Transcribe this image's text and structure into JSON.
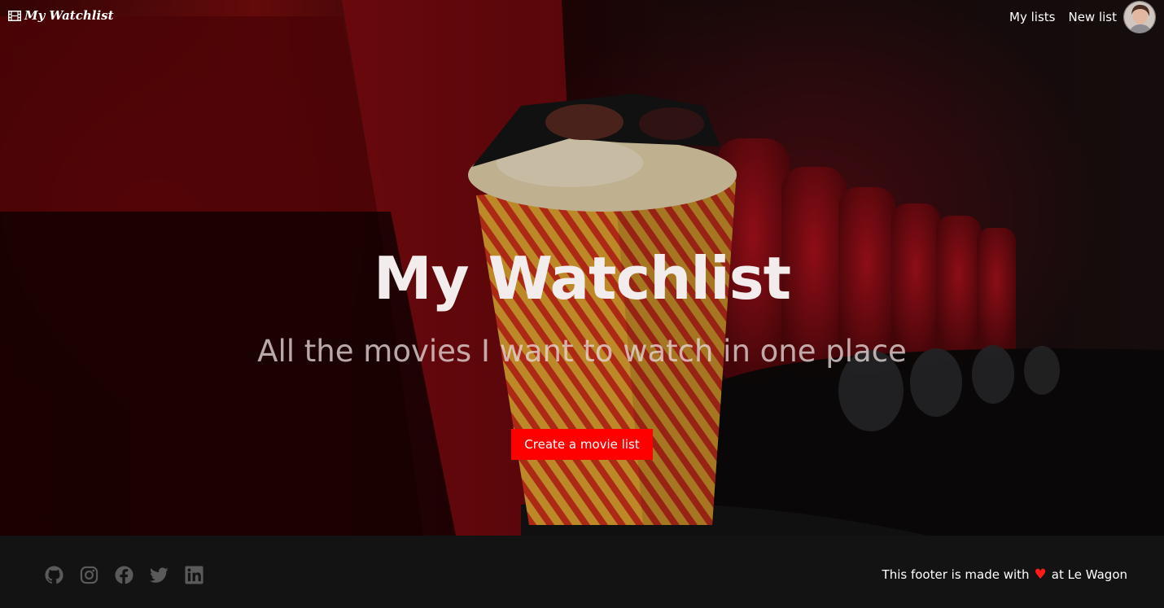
{
  "navbar": {
    "brand": "My Watchlist",
    "brand_icon": "film-icon",
    "links": [
      "My lists",
      "New list"
    ],
    "avatar": "user-avatar"
  },
  "hero": {
    "title": "My Watchlist",
    "subtitle": "All the movies I want to watch in one place",
    "cta_label": "Create a movie list",
    "cta_color": "#ff0000",
    "background": "cinema-seats-popcorn-photo"
  },
  "footer": {
    "socials": [
      "github-icon",
      "instagram-icon",
      "facebook-icon",
      "twitter-icon",
      "linkedin-icon"
    ],
    "text_before": "This footer is made with",
    "heart": "♥",
    "text_after": "at Le Wagon",
    "background": "#131313"
  }
}
